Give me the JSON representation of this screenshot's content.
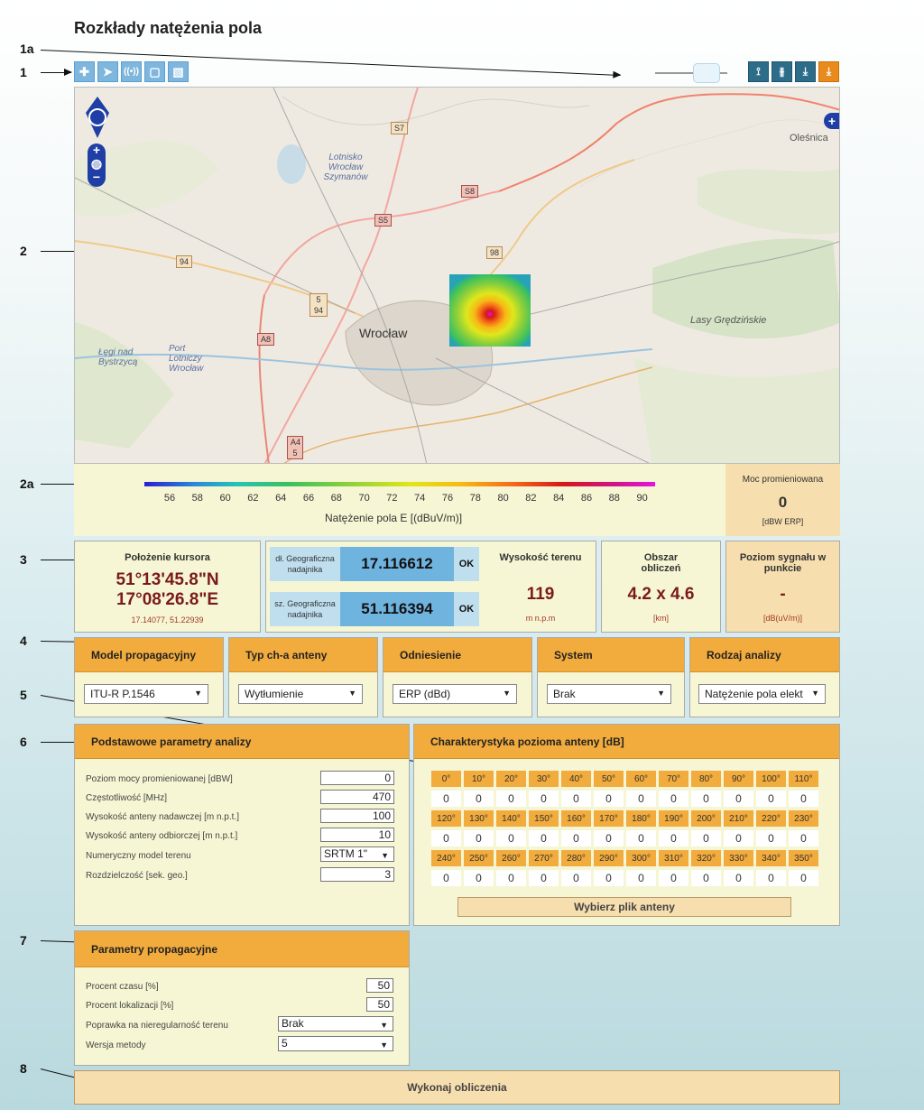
{
  "page": {
    "title": "Rozkłady natężenia pola"
  },
  "callouts": [
    "1a",
    "1",
    "2",
    "2a",
    "3",
    "4",
    "5",
    "6",
    "7",
    "8"
  ],
  "map": {
    "labels": {
      "airport": "Lotnisko Wrocław Szymanów",
      "city": "Wrocław",
      "olesnica": "Oleśnica",
      "lasy": "Lasy Grędzińskie",
      "legi": "Łęgi nad Bystrzycą",
      "port": "Port Lotniczy Wrocław"
    },
    "roads": [
      "S7",
      "S8",
      "S5",
      "98",
      "94",
      "5 94",
      "A8",
      "A4 5"
    ]
  },
  "legend": {
    "ticks": [
      "56",
      "58",
      "60",
      "62",
      "64",
      "66",
      "68",
      "70",
      "72",
      "74",
      "76",
      "78",
      "80",
      "82",
      "84",
      "86",
      "88",
      "90"
    ],
    "label": "Natężenie pola E [(dBuV/m)]",
    "moc_title": "Moc promieniowana",
    "moc_value": "0",
    "moc_unit": "[dBW ERP]"
  },
  "cursor": {
    "title": "Położenie kursora",
    "lat": "51°13'45.8\"N",
    "lon": "17°08'26.8\"E",
    "decimal": "17.14077, 51.22939"
  },
  "transmitter": {
    "lon_label": "dł. Geograficzna nadajnika",
    "lon_value": "17.116612",
    "lat_label": "sz. Geograficzna nadajnika",
    "lat_value": "51.116394",
    "ok": "OK"
  },
  "terrain": {
    "title": "Wysokość terenu",
    "value": "119",
    "unit": "m n.p.m"
  },
  "area": {
    "title": "Obszar obliczeń",
    "value": "4.2 x 4.6",
    "unit": "[km]"
  },
  "signal": {
    "title": "Poziom sygnału w punkcie",
    "value": "-",
    "unit": "[dB(uV/m)]"
  },
  "selectors": [
    {
      "title": "Model propagacyjny",
      "value": "ITU-R P.1546"
    },
    {
      "title": "Typ ch-a anteny",
      "value": "Wytłumienie"
    },
    {
      "title": "Odniesienie",
      "value": "ERP (dBd)"
    },
    {
      "title": "System",
      "value": "Brak"
    },
    {
      "title": "Rodzaj analizy",
      "value": "Natężenie pola elekt"
    }
  ],
  "basic": {
    "title": "Podstawowe parametry analizy",
    "rows": [
      {
        "label": "Poziom mocy promieniowanej [dBW]",
        "value": "0"
      },
      {
        "label": "Częstotliwość [MHz]",
        "value": "470"
      },
      {
        "label": "Wysokość anteny nadawczej [m n.p.t.]",
        "value": "100"
      },
      {
        "label": "Wysokość anteny odbiorczej [m n.p.t.]",
        "value": "10"
      }
    ],
    "terrain_label": "Numeryczny model terenu",
    "terrain_value": "SRTM 1\"",
    "res_label": "Rozdzielczość [sek. geo.]",
    "res_value": "3"
  },
  "antenna": {
    "title": "Charakterystyka pozioma anteny [dB]",
    "angles": [
      "0°",
      "10°",
      "20°",
      "30°",
      "40°",
      "50°",
      "60°",
      "70°",
      "80°",
      "90°",
      "100°",
      "110°",
      "120°",
      "130°",
      "140°",
      "150°",
      "160°",
      "170°",
      "180°",
      "190°",
      "200°",
      "210°",
      "220°",
      "230°",
      "240°",
      "250°",
      "260°",
      "270°",
      "280°",
      "290°",
      "300°",
      "310°",
      "320°",
      "330°",
      "340°",
      "350°"
    ],
    "values": [
      "0",
      "0",
      "0",
      "0",
      "0",
      "0",
      "0",
      "0",
      "0",
      "0",
      "0",
      "0",
      "0",
      "0",
      "0",
      "0",
      "0",
      "0",
      "0",
      "0",
      "0",
      "0",
      "0",
      "0",
      "0",
      "0",
      "0",
      "0",
      "0",
      "0",
      "0",
      "0",
      "0",
      "0",
      "0",
      "0"
    ],
    "file_button": "Wybierz plik anteny"
  },
  "prop": {
    "title": "Parametry propagacyjne",
    "time_label": "Procent czasu [%]",
    "time_value": "50",
    "loc_label": "Procent lokalizacji [%]",
    "loc_value": "50",
    "corr_label": "Poprawka na nieregularność terenu",
    "corr_value": "Brak",
    "ver_label": "Wersja metody",
    "ver_value": "5"
  },
  "run_button": "Wykonaj obliczenia",
  "colors": {
    "accent": "#f2ab3d",
    "panel": "#f6f6d4",
    "toolbar": "#7fb6dd",
    "toolbar_dark": "#2e6d8a"
  }
}
